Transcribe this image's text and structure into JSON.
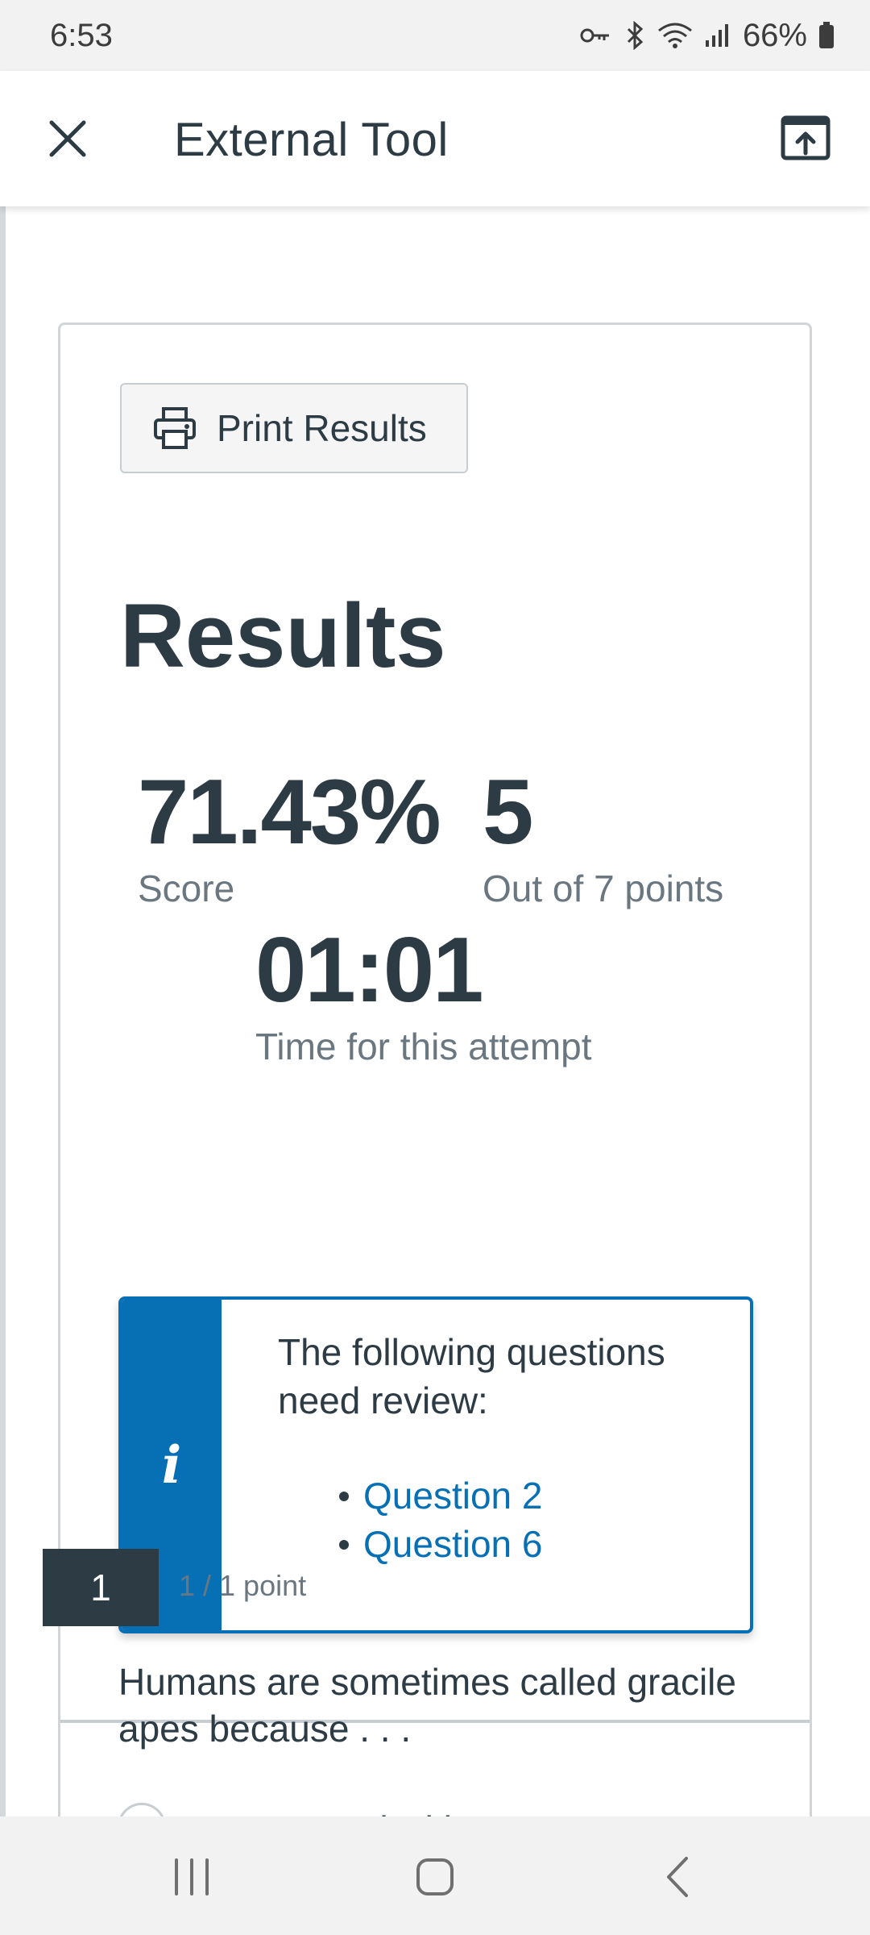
{
  "status_bar": {
    "time": "6:53",
    "battery": "66%",
    "icons": [
      "key-icon",
      "bluetooth-icon",
      "wifi-icon",
      "signal-icon",
      "battery-icon"
    ]
  },
  "header": {
    "title": "External Tool",
    "close_icon": "close-icon",
    "open_external_icon": "open-external-icon"
  },
  "results": {
    "print_button_label": "Print Results",
    "heading": "Results",
    "score_value": "71.43%",
    "score_caption": "Score",
    "points_value": "5",
    "points_caption": "Out of 7 points",
    "time_value": "01:01",
    "time_caption": "Time for this attempt"
  },
  "review_alert": {
    "icon": "i",
    "message": "The following questions need review:",
    "questions": [
      "Question 2",
      "Question 6"
    ]
  },
  "question": {
    "number": "1",
    "points": "1 / 1 point",
    "text": "Humans are sometimes called gracile apes because . . .",
    "option_partial": "... compared with"
  },
  "colors": {
    "accent": "#0770b5",
    "text_dark": "#2d3b45",
    "text_muted": "#6b7780",
    "border": "#c7cdd1"
  },
  "nav_bar": {
    "buttons": [
      "recents-button",
      "home-button",
      "back-button"
    ]
  }
}
